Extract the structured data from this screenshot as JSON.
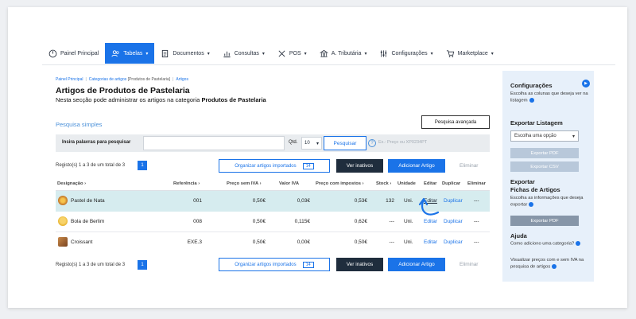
{
  "nav": [
    {
      "label": "Painel Principal",
      "icon": "dashboard-icon",
      "active": false,
      "chevron": false
    },
    {
      "label": "Tabelas",
      "icon": "users-icon",
      "active": true,
      "chevron": true
    },
    {
      "label": "Documentos",
      "icon": "document-icon",
      "active": false,
      "chevron": true
    },
    {
      "label": "Consultas",
      "icon": "chart-icon",
      "active": false,
      "chevron": true
    },
    {
      "label": "POS",
      "icon": "tools-icon",
      "active": false,
      "chevron": true
    },
    {
      "label": "A. Tributária",
      "icon": "bank-icon",
      "active": false,
      "chevron": true
    },
    {
      "label": "Configurações",
      "icon": "sliders-icon",
      "active": false,
      "chevron": true
    },
    {
      "label": "Marketplace",
      "icon": "cart-icon",
      "active": false,
      "chevron": true
    }
  ],
  "breadcrumb": {
    "home": "Painel Principal",
    "categories": "Categorias de artigos",
    "category": "[Produtos de Pastelaria]",
    "current": "Artigos"
  },
  "page": {
    "title": "Artigos de Produtos de Pastelaria",
    "subtitle_prefix": "Nesta secção pode administrar os artigos na categoria ",
    "subtitle_category": "Produtos de Pastelaria"
  },
  "search": {
    "simple_label": "Pesquisa simples",
    "advanced_button": "Pesquisa avançada",
    "input_label": "Insira palavras para pesquisar",
    "input_value": "",
    "qtd_label": "Qtd.",
    "qtd_value": "10",
    "button": "Pesquisar",
    "hint": "Ex.: Preço ou XP0234PT"
  },
  "toolbar": {
    "records": "Registo(s) 1 a 3 de um total de 3",
    "page": "1",
    "organize_button": "Organizar artigos importados",
    "organize_count": "14",
    "inactive_button": "Ver inativos",
    "add_button": "Adicionar Artigo",
    "delete_button": "Eliminar"
  },
  "table": {
    "headers": {
      "designation": "Designação",
      "reference": "Referência",
      "price_no_vat": "Preço sem IVA",
      "vat": "Valor IVA",
      "price_with_tax": "Preço com impostos",
      "stock": "Stock",
      "unit": "Unidade",
      "edit": "Editar",
      "duplicate": "Duplicar",
      "delete": "Eliminar"
    },
    "rows": [
      {
        "name": "Pastel de Nata",
        "ref": "001",
        "price": "0,50€",
        "vat": "0,03€",
        "total": "0,53€",
        "stock": "132",
        "unit": "Uni.",
        "edit": "Editar",
        "dup": "Duplicar",
        "del": "---",
        "thumb_color": "#b8651e"
      },
      {
        "name": "Bola de Berlim",
        "ref": "008",
        "price": "0,50€",
        "vat": "0,115€",
        "total": "0,62€",
        "stock": "---",
        "unit": "Uni.",
        "edit": "Editar",
        "dup": "Duplicar",
        "del": "---",
        "thumb_color": "#e0a81c"
      },
      {
        "name": "Croissant",
        "ref": "EXE.3",
        "price": "0,50€",
        "vat": "0,00€",
        "total": "0,50€",
        "stock": "---",
        "unit": "Uni.",
        "edit": "Editar",
        "dup": "Duplicar",
        "del": "---",
        "thumb_color": "#9b5a2a"
      }
    ]
  },
  "sidebar": {
    "config_title": "Configurações",
    "config_text": "Escolha as colunas que deseja ver na listagem",
    "export_title": "Exportar Listagem",
    "export_select": "Escolha uma opção",
    "export_pdf": "Exportar PDF",
    "export_csv": "Exportar CSV",
    "sheets_title_1": "Exportar",
    "sheets_title_2": "Fichas de Artigos",
    "sheets_text": "Escolha as informações que deseja exportar",
    "sheets_pdf": "Exportar PDF",
    "help_title": "Ajuda",
    "help_text_1": "Como adiciono uma categoria?",
    "help_text_2": "Visualizar preços com e sem IVA na pesquisa de artigos"
  },
  "colors": {
    "accent": "#1a73e8",
    "dark_button": "#1f2d3d",
    "highlight_row": "#d6ecef",
    "sidebar_bg": "#e7f0fa"
  }
}
